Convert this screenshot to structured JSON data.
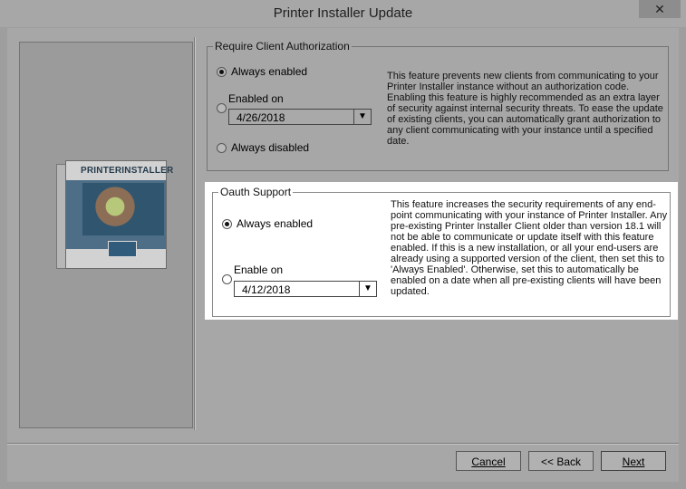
{
  "window": {
    "title": "Printer Installer Update",
    "close_glyph": "✕"
  },
  "branding": {
    "product_box_logo": "PRINTERINSTALLER",
    "icon_name": "printer-installer-box-art"
  },
  "require_client_authorization": {
    "title": "Require Client Authorization",
    "options": [
      {
        "label": "Always enabled",
        "selected": true
      },
      {
        "label": "Enabled on",
        "selected": false
      },
      {
        "label": "Always disabled",
        "selected": false
      }
    ],
    "date_value": "4/26/2018",
    "description": "This feature prevents new clients from communicating to your Printer Installer instance without an authorization code.  Enabling this feature is highly recommended as an extra layer of security against internal security threats.  To ease the update of existing clients, you can automatically grant authorization to any client communicating with your instance until a specified date."
  },
  "oauth_support": {
    "title": "Oauth Support",
    "options": [
      {
        "label": "Always enabled",
        "selected": true
      },
      {
        "label": "Enable on",
        "selected": false
      }
    ],
    "date_value": "4/12/2018",
    "description": "This feature increases the security requirements of any end-point communicating with your instance of Printer Installer.  Any pre-existing Printer Installer Client older than version 18.1 will not be able to communicate or update itself with this feature enabled.  If this is a new installation, or all your end-users are already using a supported version of the client, then set this to 'Always Enabled'.  Otherwise, set this to automatically be enabled on a date when all pre-existing clients will have been updated."
  },
  "buttons": {
    "cancel": "Cancel",
    "back": "<< Back",
    "next": "Next"
  },
  "colors": {
    "highlight": "#ffffff",
    "dimmed_background": "#a7a7a7"
  }
}
